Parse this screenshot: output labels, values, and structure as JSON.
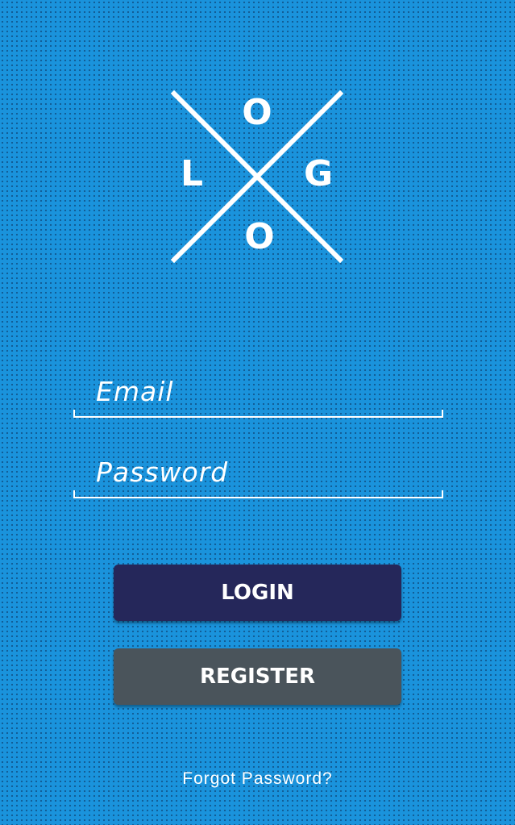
{
  "logo": {
    "letters": {
      "top": "O",
      "left": "L",
      "right": "G",
      "bottom": "O"
    }
  },
  "form": {
    "email_placeholder": "Email",
    "password_placeholder": "Password"
  },
  "buttons": {
    "login_label": "LOGIN",
    "register_label": "REGISTER"
  },
  "links": {
    "forgot_password": "Forgot Password?"
  },
  "colors": {
    "background": "#1a93dc",
    "login_button": "#25275a",
    "register_button": "#4a545b",
    "text": "#ffffff"
  }
}
